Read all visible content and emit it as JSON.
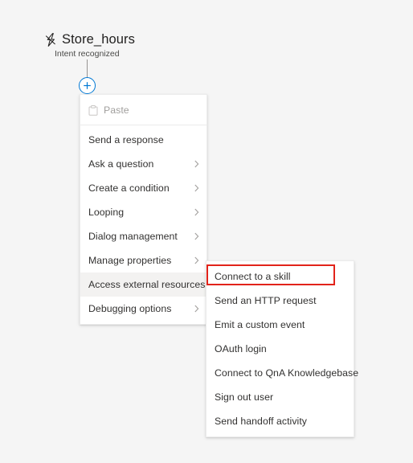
{
  "canvas": {
    "background_color": "#f5f5f5"
  },
  "node": {
    "icon": "lightning-bolt-icon",
    "title": "Store_hours",
    "subtitle": "Intent recognized",
    "add_button": {
      "icon": "plus-icon",
      "accent_color": "#0078d4"
    }
  },
  "primary_menu": {
    "items": [
      {
        "label": "Paste",
        "icon": "clipboard-icon",
        "disabled": true,
        "submenu": false,
        "highlighted": false,
        "separator_after": true
      },
      {
        "label": "Send a response",
        "icon": null,
        "disabled": false,
        "submenu": false,
        "highlighted": false,
        "separator_after": false
      },
      {
        "label": "Ask a question",
        "icon": null,
        "disabled": false,
        "submenu": true,
        "highlighted": false,
        "separator_after": false
      },
      {
        "label": "Create a condition",
        "icon": null,
        "disabled": false,
        "submenu": true,
        "highlighted": false,
        "separator_after": false
      },
      {
        "label": "Looping",
        "icon": null,
        "disabled": false,
        "submenu": true,
        "highlighted": false,
        "separator_after": false
      },
      {
        "label": "Dialog management",
        "icon": null,
        "disabled": false,
        "submenu": true,
        "highlighted": false,
        "separator_after": false
      },
      {
        "label": "Manage properties",
        "icon": null,
        "disabled": false,
        "submenu": true,
        "highlighted": false,
        "separator_after": false
      },
      {
        "label": "Access external resources",
        "icon": null,
        "disabled": false,
        "submenu": true,
        "highlighted": true,
        "separator_after": false
      },
      {
        "label": "Debugging options",
        "icon": null,
        "disabled": false,
        "submenu": true,
        "highlighted": false,
        "separator_after": false
      }
    ]
  },
  "submenu": {
    "parent_label": "Access external resources",
    "items": [
      {
        "label": "Connect to a skill",
        "annotated": true
      },
      {
        "label": "Send an HTTP request",
        "annotated": false
      },
      {
        "label": "Emit a custom event",
        "annotated": false
      },
      {
        "label": "OAuth login",
        "annotated": false
      },
      {
        "label": "Connect to QnA Knowledgebase",
        "annotated": false
      },
      {
        "label": "Sign out user",
        "annotated": false
      },
      {
        "label": "Send handoff activity",
        "annotated": false
      }
    ]
  },
  "annotation": {
    "target_label": "Connect to a skill",
    "color": "#e2231a"
  }
}
